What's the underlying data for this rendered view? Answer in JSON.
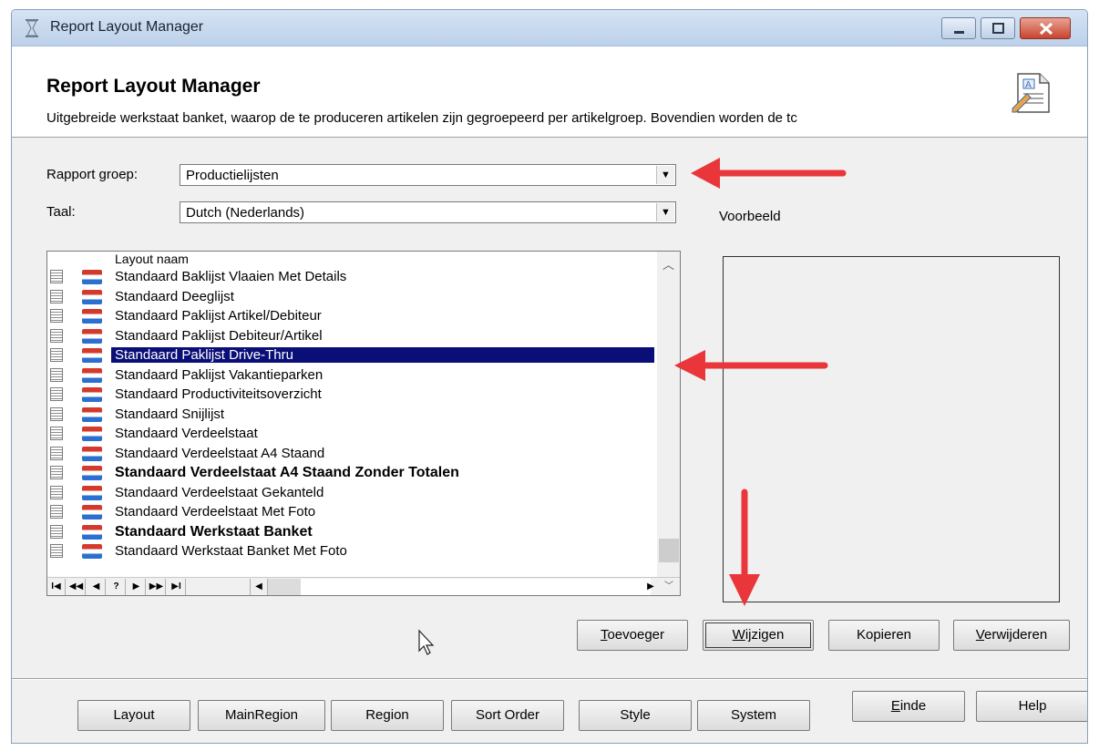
{
  "window": {
    "title": "Report Layout Manager"
  },
  "header": {
    "title": "Report Layout Manager",
    "description": "Uitgebreide werkstaat banket, waarop de te produceren artikelen zijn gegroepeerd per artikelgroep. Bovendien worden de tc"
  },
  "form": {
    "rapport_groep_label": "Rapport groep:",
    "rapport_groep_value": "Productielijsten",
    "taal_label": "Taal:",
    "taal_value": "Dutch (Nederlands)"
  },
  "preview": {
    "label": "Voorbeeld"
  },
  "grid": {
    "column_header": "Layout naam",
    "rows": [
      {
        "name": "Standaard Baklijst Vlaaien Met Details",
        "bold": false,
        "selected": false
      },
      {
        "name": "Standaard Deeglijst",
        "bold": false,
        "selected": false
      },
      {
        "name": "Standaard Paklijst Artikel/Debiteur",
        "bold": false,
        "selected": false
      },
      {
        "name": "Standaard Paklijst Debiteur/Artikel",
        "bold": false,
        "selected": false
      },
      {
        "name": "Standaard Paklijst Drive-Thru",
        "bold": false,
        "selected": true
      },
      {
        "name": "Standaard Paklijst Vakantieparken",
        "bold": false,
        "selected": false
      },
      {
        "name": "Standaard Productiviteitsoverzicht",
        "bold": false,
        "selected": false
      },
      {
        "name": "Standaard Snijlijst",
        "bold": false,
        "selected": false
      },
      {
        "name": "Standaard Verdeelstaat",
        "bold": false,
        "selected": false
      },
      {
        "name": "Standaard Verdeelstaat A4 Staand",
        "bold": false,
        "selected": false
      },
      {
        "name": "Standaard Verdeelstaat A4 Staand Zonder Totalen",
        "bold": true,
        "selected": false
      },
      {
        "name": "Standaard Verdeelstaat Gekanteld",
        "bold": false,
        "selected": false
      },
      {
        "name": "Standaard Verdeelstaat Met Foto",
        "bold": false,
        "selected": false
      },
      {
        "name": "Standaard Werkstaat Banket",
        "bold": true,
        "selected": false
      },
      {
        "name": "Standaard Werkstaat Banket Met Foto",
        "bold": false,
        "selected": false
      }
    ],
    "nav": [
      "I◀",
      "◀◀",
      "◀",
      "?",
      "▶",
      "▶▶",
      "▶I"
    ]
  },
  "actions": {
    "add": "Toevoeger",
    "edit": "Wijzigen",
    "copy": "Kopieren",
    "delete": "Verwijderen"
  },
  "bottom": {
    "layout": "Layout",
    "mainregion": "MainRegion",
    "region": "Region",
    "sort_order": "Sort Order",
    "style": "Style",
    "system": "System",
    "end": "Einde",
    "help": "Help"
  },
  "colors": {
    "selection": "#0a0f78",
    "annotation_arrow": "#e8363a",
    "close_button": "#c8442d"
  }
}
